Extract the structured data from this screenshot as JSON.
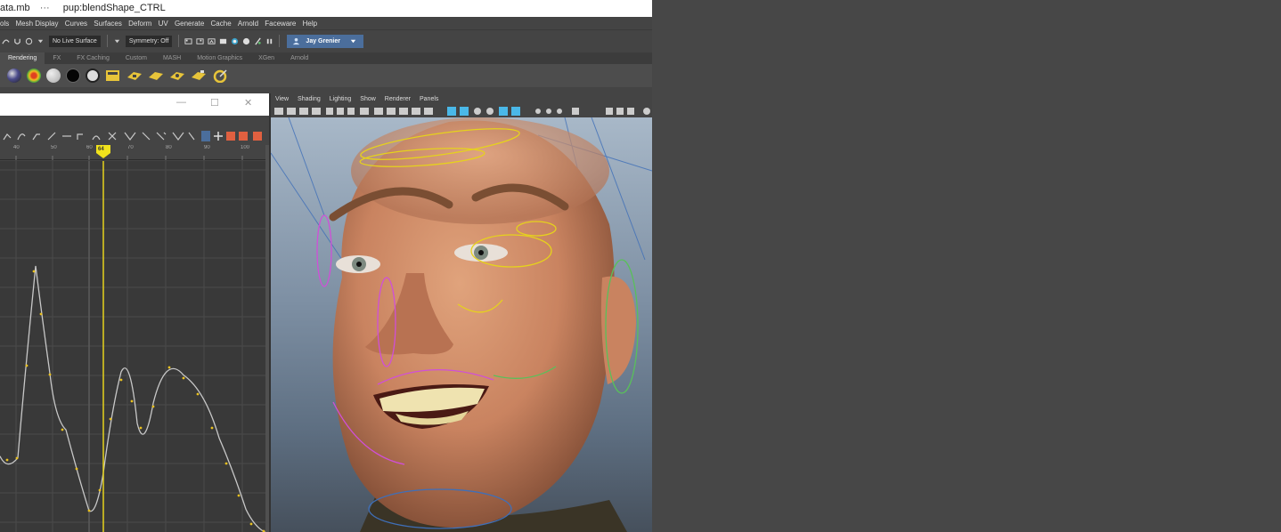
{
  "window": {
    "file_name": "ata.mb",
    "separator": "···",
    "object": "pup:blendShape_CTRL"
  },
  "menubar": {
    "items": [
      "ols",
      "Mesh Display",
      "Curves",
      "Surfaces",
      "Deform",
      "UV",
      "Generate",
      "Cache",
      "Arnold",
      "Faceware",
      "Help"
    ]
  },
  "statusline": {
    "live_surface": "No Live Surface",
    "symmetry": "Symmetry: Off",
    "user": "Jay Grenier"
  },
  "shelf": {
    "tabs": [
      "Rendering",
      "FX",
      "FX Caching",
      "Custom",
      "MASH",
      "Motion Graphics",
      "XGen",
      "Arnold"
    ],
    "active_tab": "Rendering"
  },
  "graph_editor": {
    "current_frame": "64",
    "ruler_labels": [
      "40",
      "50",
      "60",
      "70",
      "80",
      "90",
      "100"
    ],
    "curve_color": "#c8c8c8",
    "key_color": "#e8c020",
    "time_cursor_color": "#e6d21c"
  },
  "viewport": {
    "menu": [
      "View",
      "Shading",
      "Lighting",
      "Show",
      "Renderer",
      "Panels"
    ]
  },
  "colors": {
    "user_button": "#4b6e9c",
    "background": "#474747"
  }
}
